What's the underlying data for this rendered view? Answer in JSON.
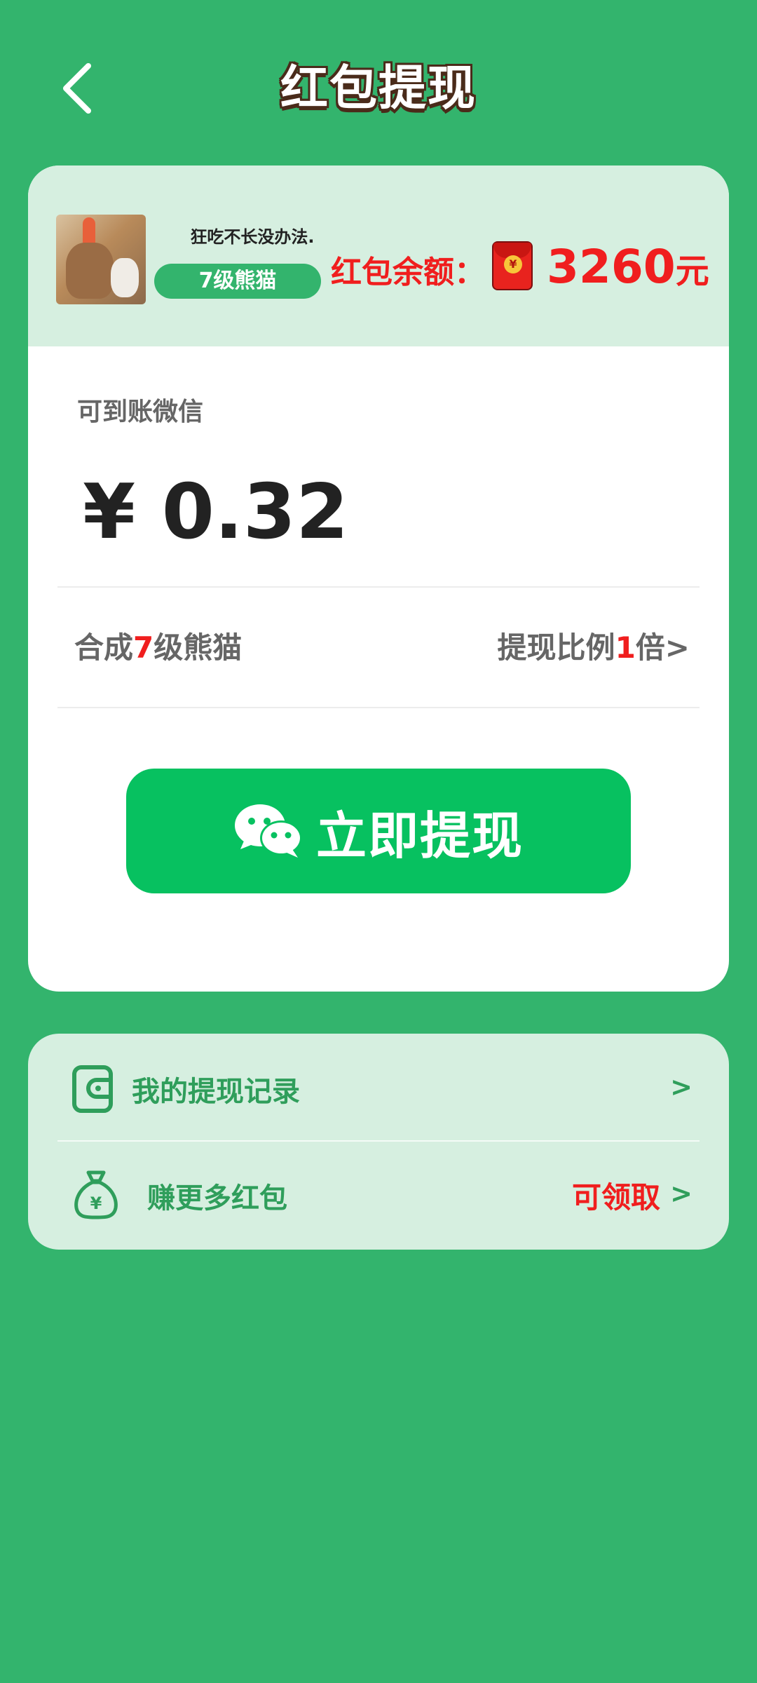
{
  "header": {
    "title": "红包提现"
  },
  "profile": {
    "nickname": "狂吃不长没办法.",
    "level_badge": "7级熊猫"
  },
  "balance": {
    "label": "红包余额：",
    "coin_symbol": "¥",
    "value": "3260",
    "unit": "元"
  },
  "withdraw": {
    "arrive_label": "可到账微信",
    "amount": "¥ 0.32",
    "condition": {
      "prefix": "合成",
      "level": "7",
      "suffix": "级熊猫"
    },
    "ratio": {
      "prefix": "提现比例",
      "value": "1",
      "suffix": "倍>"
    },
    "button_label": "立即提现"
  },
  "menu": {
    "records_label": "我的提现记录",
    "records_chevron": ">",
    "earn_label": "赚更多红包",
    "earn_tag": "可领取",
    "earn_chevron": ">",
    "earn_icon_symbol": "¥"
  },
  "colors": {
    "background": "#33b46d",
    "accent_red": "#f01e1e",
    "wechat_green": "#07c160",
    "card_tint": "#d6efe0"
  },
  "icons": [
    "back-arrow-icon",
    "red-packet-icon",
    "wechat-icon",
    "wallet-icon",
    "money-bag-icon"
  ]
}
